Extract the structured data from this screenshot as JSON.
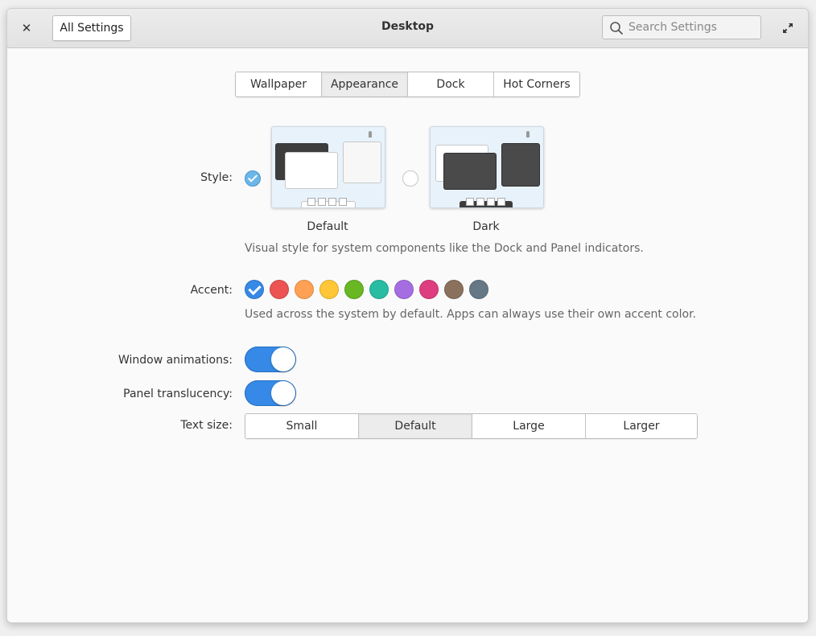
{
  "header": {
    "close_glyph": "✕",
    "back_label": "All Settings",
    "title": "Desktop",
    "search_placeholder": "Search Settings"
  },
  "tabs": [
    {
      "label": "Wallpaper",
      "active": false
    },
    {
      "label": "Appearance",
      "active": true
    },
    {
      "label": "Dock",
      "active": false
    },
    {
      "label": "Hot Corners",
      "active": false
    }
  ],
  "style": {
    "label": "Style:",
    "options": [
      {
        "label": "Default",
        "selected": true
      },
      {
        "label": "Dark",
        "selected": false
      }
    ],
    "description": "Visual style for system components like the Dock and Panel indicators."
  },
  "accent": {
    "label": "Accent:",
    "colors": [
      "#3689e6",
      "#ed5353",
      "#ffa154",
      "#ffc737",
      "#68b723",
      "#28bca3",
      "#a56de2",
      "#de3e80",
      "#8a715e",
      "#667885"
    ],
    "selected_index": 0,
    "description": "Used across the system by default. Apps can always use their own accent color."
  },
  "window_animations": {
    "label": "Window animations:",
    "enabled": true
  },
  "panel_translucency": {
    "label": "Panel translucency:",
    "enabled": true
  },
  "text_size": {
    "label": "Text size:",
    "options": [
      {
        "label": "Small",
        "active": false
      },
      {
        "label": "Default",
        "active": true
      },
      {
        "label": "Large",
        "active": false
      },
      {
        "label": "Larger",
        "active": false
      }
    ]
  }
}
